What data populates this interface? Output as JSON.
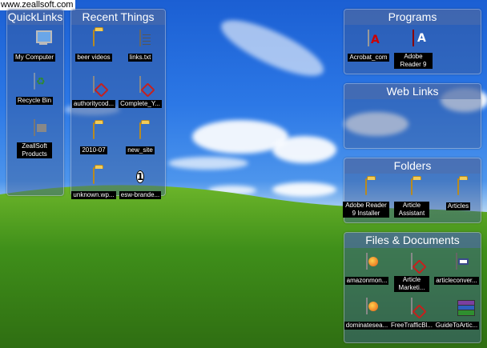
{
  "watermark": "www.zeallsoft.com",
  "quicklinks": {
    "title": "QuickLinks",
    "items": [
      {
        "label": "My Computer",
        "icon": "computer-icon"
      },
      {
        "label": "Recycle Bin",
        "icon": "recycle-bin-icon"
      },
      {
        "label": "ZeallSoft Products",
        "icon": "zeallsoft-icon"
      }
    ]
  },
  "recent": {
    "title": "Recent Things",
    "items": [
      {
        "label": "beer videos",
        "icon": "folder-icon"
      },
      {
        "label": "links.txt",
        "icon": "text-file-icon"
      },
      {
        "label": "authoritycod...",
        "icon": "pdf-icon"
      },
      {
        "label": "Complete_Y...",
        "icon": "pdf-icon"
      },
      {
        "label": "2010-07",
        "icon": "folder-icon"
      },
      {
        "label": "new_site",
        "icon": "folder-icon"
      },
      {
        "label": "unknown.wp...",
        "icon": "folder-icon"
      },
      {
        "label": "esw-brande...",
        "icon": "number-one-icon",
        "glyph": "1"
      }
    ]
  },
  "programs": {
    "title": "Programs",
    "items": [
      {
        "label": "Acrobat_com",
        "icon": "acrobat-icon"
      },
      {
        "label": "Adobe Reader 9",
        "icon": "adobe-reader-icon"
      }
    ]
  },
  "weblinks": {
    "title": "Web Links"
  },
  "folders": {
    "title": "Folders",
    "items": [
      {
        "label": "Adobe Reader 9 Installer",
        "icon": "folder-icon"
      },
      {
        "label": "Article Assistant",
        "icon": "folder-icon"
      },
      {
        "label": "Articles",
        "icon": "folder-icon"
      }
    ]
  },
  "files": {
    "title": "Files & Documents",
    "items": [
      {
        "label": "amazonmon...",
        "icon": "firefox-doc-icon"
      },
      {
        "label": "Article Marketi...",
        "icon": "pdf-icon"
      },
      {
        "label": "articleconver...",
        "icon": "vcard-icon"
      },
      {
        "label": "dominatesea...",
        "icon": "firefox-doc-icon"
      },
      {
        "label": "FreeTrafficBl...",
        "icon": "pdf-icon"
      },
      {
        "label": "GuideToArtic...",
        "icon": "winrar-icon"
      }
    ]
  },
  "colors": {
    "panel_bg": "#3c5a96",
    "sky_top": "#1b5fd3",
    "grass": "#3f8f1a"
  }
}
